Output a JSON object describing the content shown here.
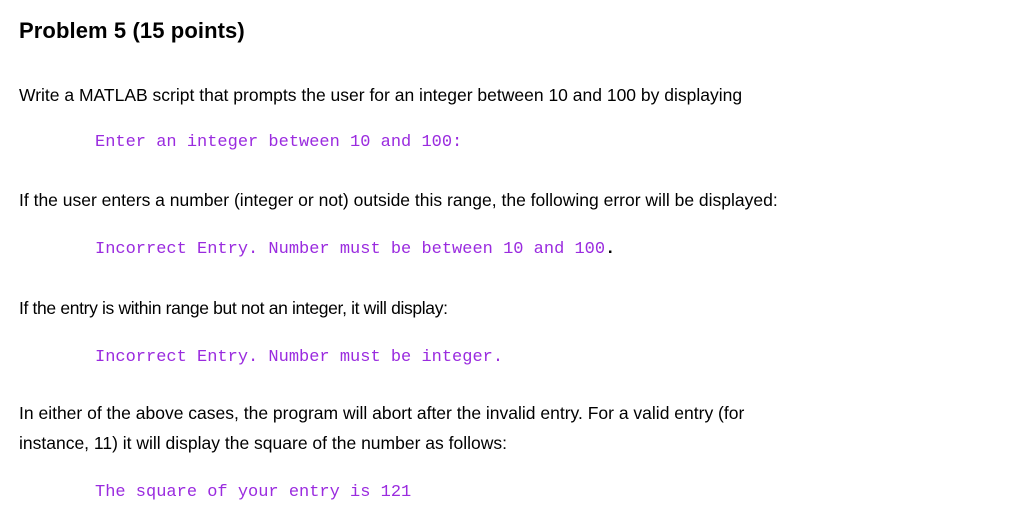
{
  "document": {
    "title": "Problem 5 (15 points)",
    "colors": {
      "text": "#000000",
      "code": "#9a2bdf"
    },
    "paragraphs": [
      "Write a MATLAB script that prompts the user for an integer between 10 and 100 by displaying",
      "If the user enters a number (integer or not) outside this range, the following error will be displayed:",
      "If the entry is within range but not an integer, it will display:",
      "In either of the above cases, the program will abort after the invalid entry. For a valid entry (for",
      "instance, 11) it will display the square of the number as follows:"
    ],
    "code_samples": {
      "prompt": "Enter an integer between 10 and 100:",
      "range_error": "Incorrect Entry. Number must be between 10 and 100",
      "range_error_terminator": ".",
      "integer_error": "Incorrect Entry. Number must be integer.",
      "square_output": "The square of your entry is 121"
    }
  }
}
